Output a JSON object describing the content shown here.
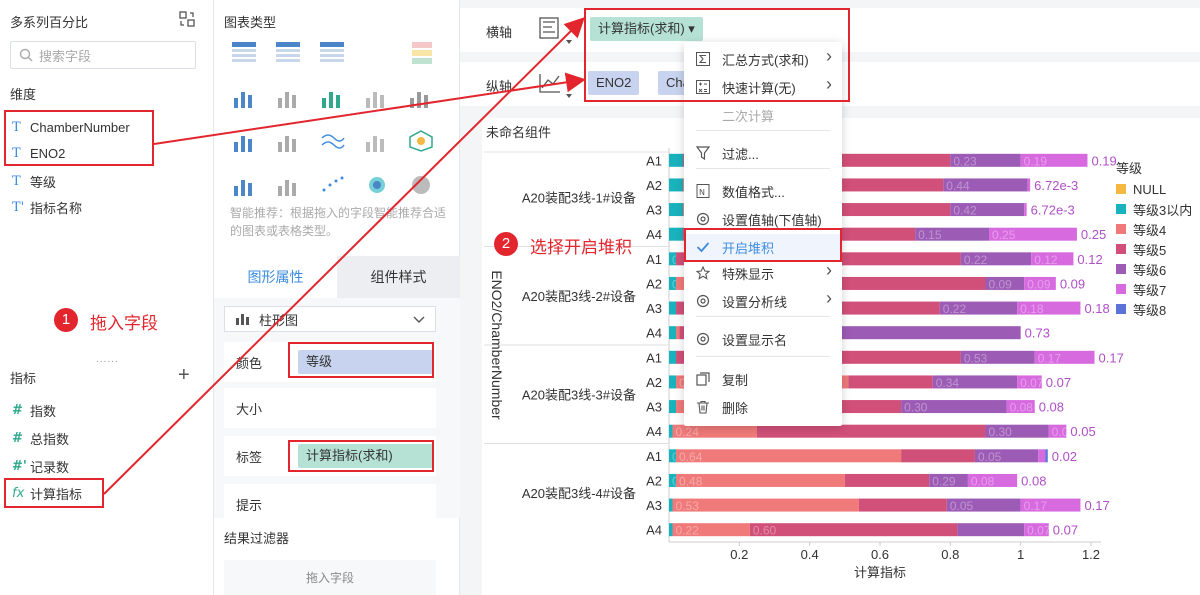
{
  "left_panel": {
    "title": "多系列百分比",
    "search_placeholder": "搜索字段",
    "dimension_label": "维度",
    "dimensions": [
      {
        "icon": "T",
        "label": "ChamberNumber"
      },
      {
        "icon": "T",
        "label": "ENO2"
      },
      {
        "icon": "T",
        "label": "等级"
      },
      {
        "icon": "T'",
        "label": "指标名称"
      }
    ],
    "metric_label": "指标",
    "metrics": [
      {
        "icon": "#",
        "label": "指数"
      },
      {
        "icon": "#",
        "label": "总指数"
      },
      {
        "icon": "#'",
        "label": "记录数"
      },
      {
        "icon": "fx",
        "label": "计算指标"
      }
    ],
    "annotation_num": "1",
    "annotation_text": "拖入字段"
  },
  "mid_panel": {
    "title": "图表类型",
    "hint": "智能推荐：根据拖入的字段智能推荐合适的图表或表格类型。",
    "tabs": [
      "图形属性",
      "组件样式"
    ],
    "chart_select": "柱形图",
    "props": [
      {
        "label": "颜色",
        "value": "等级"
      },
      {
        "label": "大小",
        "value": ""
      },
      {
        "label": "标签",
        "value": "计算指标(求和)"
      },
      {
        "label": "提示",
        "value": ""
      }
    ],
    "filter_title": "结果过滤器",
    "filter_drop": "拖入字段",
    "chart_type_tile": "123"
  },
  "main": {
    "x_axis_label": "横轴",
    "y_axis_label": "纵轴",
    "x_pill": "计算指标(求和) ▾",
    "y_pills": [
      "ENO2",
      "Cha"
    ],
    "component_title": "未命名组件",
    "annotation_num": "2",
    "annotation_text": "选择开启堆积"
  },
  "menu": {
    "items": [
      {
        "label": "汇总方式(求和)",
        "icon": "sigma-icon",
        "arrow": true,
        "state": "normal"
      },
      {
        "label": "快速计算(无)",
        "icon": "calculator-icon",
        "arrow": true,
        "state": "normal"
      },
      {
        "label": "二次计算",
        "icon": "",
        "arrow": false,
        "state": "disabled"
      },
      {
        "label": "过滤...",
        "icon": "filter-icon",
        "arrow": false,
        "state": "normal"
      },
      {
        "label": "数值格式...",
        "icon": "number-format-icon",
        "arrow": false,
        "state": "normal"
      },
      {
        "label": "设置值轴(下值轴)",
        "icon": "gear-icon",
        "arrow": false,
        "state": "normal"
      },
      {
        "label": "开启堆积",
        "icon": "check-icon",
        "arrow": false,
        "state": "active"
      },
      {
        "label": "特殊显示",
        "icon": "star-icon",
        "arrow": true,
        "state": "normal"
      },
      {
        "label": "设置分析线",
        "icon": "gear-icon",
        "arrow": true,
        "state": "normal"
      },
      {
        "label": "设置显示名",
        "icon": "gear-icon",
        "arrow": false,
        "state": "normal"
      },
      {
        "label": "复制",
        "icon": "copy-icon",
        "arrow": false,
        "state": "normal"
      },
      {
        "label": "删除",
        "icon": "trash-icon",
        "arrow": false,
        "state": "normal"
      }
    ]
  },
  "colors": {
    "等级3以内": "#19b3bd",
    "等级4": "#f07a7a",
    "等级5": "#d1507a",
    "等级6": "#9c5bb5",
    "等级7": "#d86ae0",
    "等级8": "#5b72d6",
    "NULL": "#f5b841",
    "accent": "#3d8ce0",
    "annotation": "#e3262e"
  },
  "chart_data": {
    "type": "bar",
    "orientation": "horizontal",
    "stacked": true,
    "xlabel": "计算指标",
    "ylabel": "ENO2/ChamberNumber",
    "xlim": [
      0,
      1.2
    ],
    "xticks": [
      "0.2",
      "0.4",
      "0.6",
      "0.8",
      "1",
      "1.2"
    ],
    "legend_title": "等级",
    "legend_position": "right",
    "legend": [
      "NULL",
      "等级3以内",
      "等级4",
      "等级5",
      "等级6",
      "等级7",
      "等级8"
    ],
    "groups": [
      {
        "name": "A20装配3线-1#设备",
        "rows": [
          {
            "label": "A1",
            "segments": [
              [
                "等级3以内",
                0.04,
                ""
              ],
              [
                "等级4",
                0.0,
                ""
              ],
              [
                "等级5",
                0.76,
                "0.55"
              ],
              [
                "等级6",
                0.2,
                "0.23"
              ],
              [
                "等级7",
                0.19,
                "0.19"
              ]
            ]
          },
          {
            "label": "A2",
            "segments": [
              [
                "等级3以内",
                0.04,
                ""
              ],
              [
                "等级4",
                0.05,
                ""
              ],
              [
                "等级5",
                0.69,
                ""
              ],
              [
                "等级6",
                0.24,
                "0.44"
              ],
              [
                "等级7",
                0.007,
                "6.72e-3"
              ]
            ]
          },
          {
            "label": "A3",
            "segments": [
              [
                "等级3以内",
                0.04,
                ""
              ],
              [
                "等级4",
                0.1,
                ""
              ],
              [
                "等级5",
                0.66,
                ""
              ],
              [
                "等级6",
                0.21,
                "0.42"
              ],
              [
                "等级7",
                0.007,
                "6.72e-3"
              ]
            ]
          },
          {
            "label": "A4",
            "segments": [
              [
                "等级3以内",
                0.04,
                ""
              ],
              [
                "等级4",
                0.0,
                ""
              ],
              [
                "等级5",
                0.66,
                ""
              ],
              [
                "等级6",
                0.21,
                "0.15"
              ],
              [
                "等级7",
                0.25,
                "0.25"
              ]
            ]
          }
        ]
      },
      {
        "name": "A20装配3线-2#设备",
        "rows": [
          {
            "label": "A1",
            "segments": [
              [
                "等级3以内",
                0.02,
                "0.01"
              ],
              [
                "等级4",
                0.0,
                ""
              ],
              [
                "等级5",
                0.81,
                ""
              ],
              [
                "等级6",
                0.2,
                "0.22"
              ],
              [
                "等级7",
                0.12,
                "0.12"
              ]
            ]
          },
          {
            "label": "A2",
            "segments": [
              [
                "等级3以内",
                0.02,
                "0.01"
              ],
              [
                "等级4",
                0.06,
                ""
              ],
              [
                "等级5",
                0.82,
                ""
              ],
              [
                "等级6",
                0.11,
                "0.09"
              ],
              [
                "等级7",
                0.09,
                "0.09"
              ]
            ]
          },
          {
            "label": "A3",
            "segments": [
              [
                "等级3以内",
                0.02,
                ""
              ],
              [
                "等级4",
                0.0,
                ""
              ],
              [
                "等级5",
                0.75,
                ""
              ],
              [
                "等级6",
                0.22,
                "0.22"
              ],
              [
                "等级7",
                0.18,
                "0.18"
              ]
            ]
          },
          {
            "label": "A4",
            "segments": [
              [
                "等级3以内",
                0.02,
                ""
              ],
              [
                "等级4",
                0.01,
                ""
              ],
              [
                "等级5",
                0.37,
                ""
              ],
              [
                "等级6",
                0.6,
                ""
              ],
              [
                "等级7",
                0.0,
                "0.73"
              ]
            ]
          }
        ]
      },
      {
        "name": "A20装配3线-3#设备",
        "rows": [
          {
            "label": "A1",
            "segments": [
              [
                "等级3以内",
                0.02,
                ""
              ],
              [
                "等级4",
                0.0,
                ""
              ],
              [
                "等级5",
                0.81,
                ""
              ],
              [
                "等级6",
                0.21,
                "0.53"
              ],
              [
                "等级7",
                0.17,
                "0.17"
              ]
            ]
          },
          {
            "label": "A2",
            "segments": [
              [
                "等级3以内",
                0.02,
                ""
              ],
              [
                "等级4",
                0.49,
                "0.49"
              ],
              [
                "等级5",
                0.24,
                ""
              ],
              [
                "等级6",
                0.24,
                "0.34"
              ],
              [
                "等级7",
                0.07,
                "0.07"
              ]
            ]
          },
          {
            "label": "A3",
            "segments": [
              [
                "等级3以内",
                0.02,
                ""
              ],
              [
                "等级4",
                0.14,
                ""
              ],
              [
                "等级5",
                0.5,
                "0.44"
              ],
              [
                "等级6",
                0.3,
                "0.30"
              ],
              [
                "等级7",
                0.08,
                "0.08"
              ]
            ]
          },
          {
            "label": "A4",
            "segments": [
              [
                "等级3以内",
                0.01,
                "0.01"
              ],
              [
                "等级4",
                0.24,
                "0.24"
              ],
              [
                "等级5",
                0.65,
                ""
              ],
              [
                "等级6",
                0.18,
                "0.30"
              ],
              [
                "等级7",
                0.05,
                "0.05"
              ]
            ]
          }
        ]
      },
      {
        "name": "A20装配3线-4#设备",
        "rows": [
          {
            "label": "A1",
            "segments": [
              [
                "等级3以内",
                0.02,
                "0.02"
              ],
              [
                "等级4",
                0.64,
                "0.64"
              ],
              [
                "等级5",
                0.21,
                ""
              ],
              [
                "等级6",
                0.18,
                "0.05"
              ],
              [
                "等级7",
                0.02,
                ""
              ],
              [
                "等级8",
                0.007,
                "0.02"
              ]
            ]
          },
          {
            "label": "A2",
            "segments": [
              [
                "等级3以内",
                0.02,
                "0.02"
              ],
              [
                "等级4",
                0.48,
                "0.48"
              ],
              [
                "等级5",
                0.24,
                ""
              ],
              [
                "等级6",
                0.11,
                "0.29"
              ],
              [
                "等级7",
                0.14,
                "0.08"
              ]
            ]
          },
          {
            "label": "A3",
            "segments": [
              [
                "等级3以内",
                0.01,
                "0.01"
              ],
              [
                "等级4",
                0.53,
                "0.53"
              ],
              [
                "等级5",
                0.25,
                ""
              ],
              [
                "等级6",
                0.21,
                "0.05"
              ],
              [
                "等级7",
                0.17,
                "0.17"
              ]
            ]
          },
          {
            "label": "A4",
            "segments": [
              [
                "等级3以内",
                0.01,
                "9.85e-3"
              ],
              [
                "等级4",
                0.22,
                "0.22"
              ],
              [
                "等级5",
                0.59,
                "0.60"
              ],
              [
                "等级6",
                0.19,
                ""
              ],
              [
                "等级7",
                0.07,
                "0.07"
              ]
            ]
          }
        ]
      }
    ]
  }
}
